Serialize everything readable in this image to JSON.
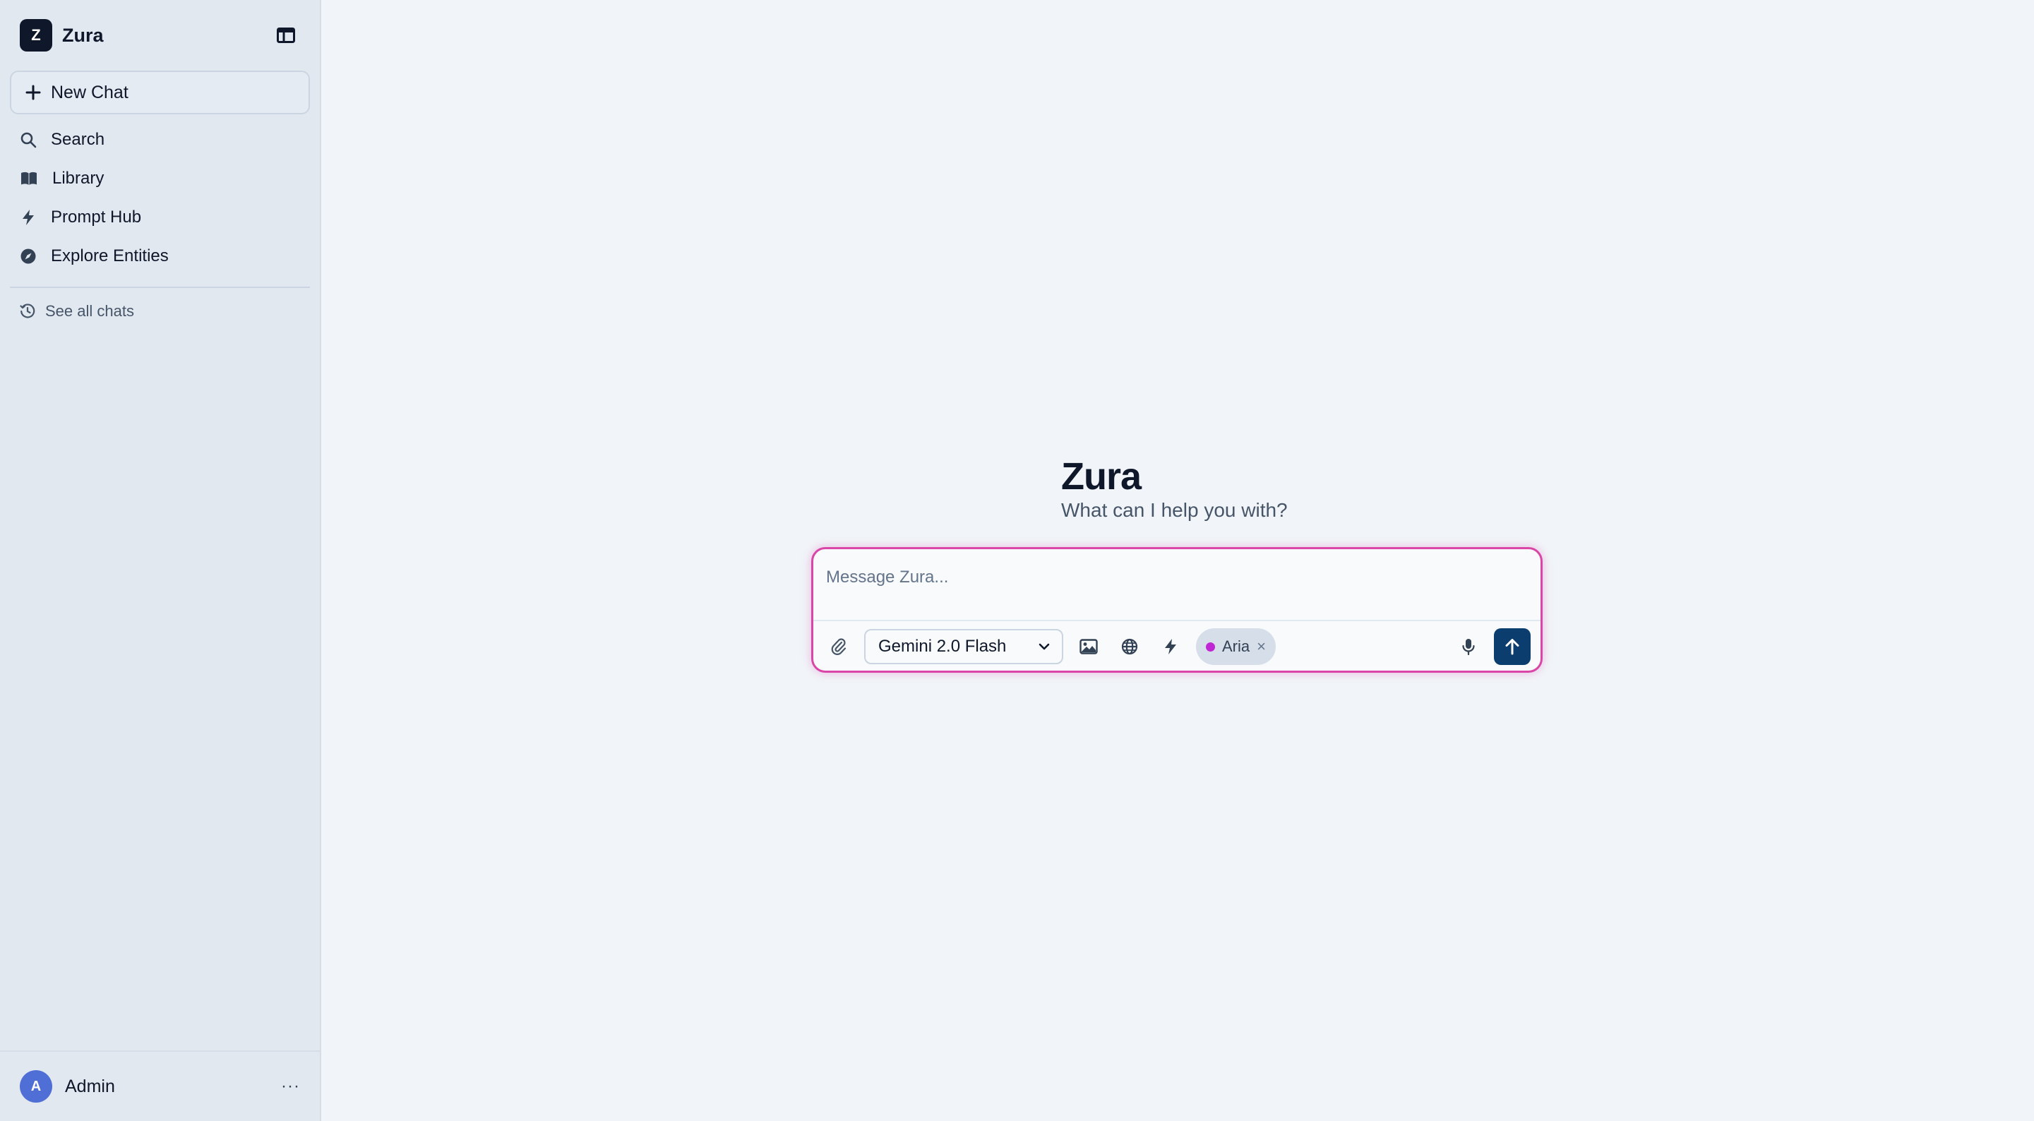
{
  "app": {
    "logo_letter": "Z",
    "name": "Zura"
  },
  "sidebar": {
    "new_chat_label": "New Chat",
    "items": [
      {
        "label": "Search",
        "icon": "search-icon"
      },
      {
        "label": "Library",
        "icon": "book-icon"
      },
      {
        "label": "Prompt Hub",
        "icon": "lightning-icon"
      },
      {
        "label": "Explore Entities",
        "icon": "compass-icon"
      }
    ],
    "see_all_label": "See all chats"
  },
  "user": {
    "avatar_letter": "A",
    "name": "Admin",
    "menu_glyph": "···"
  },
  "hero": {
    "title": "Zura",
    "subtitle": "What can I help you with?"
  },
  "composer": {
    "placeholder": "Message Zura...",
    "value": "",
    "model": "Gemini 2.0 Flash",
    "chip": {
      "label": "Aria",
      "close": "×"
    }
  },
  "colors": {
    "accent": "#d946a8",
    "send_button": "#0b3e6f",
    "sidebar_bg": "#e2e8f0",
    "main_bg": "#f1f5f9"
  }
}
